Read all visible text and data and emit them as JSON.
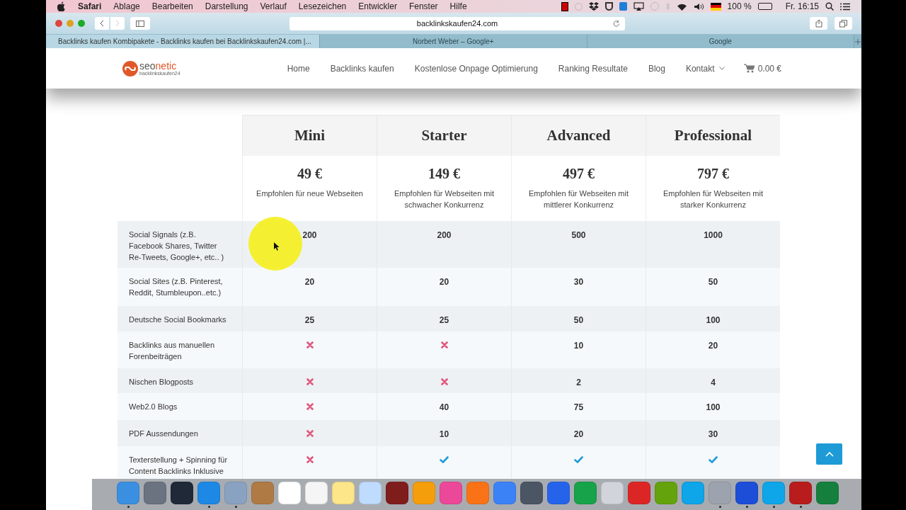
{
  "menubar": {
    "app": "Safari",
    "menus": [
      "Ablage",
      "Bearbeiten",
      "Darstellung",
      "Verlauf",
      "Lesezeichen",
      "Entwickler",
      "Fenster",
      "Hilfe"
    ],
    "battery": "100 %",
    "clock": "Fr. 16:15"
  },
  "toolbar": {
    "address": "backlinkskaufen24.com"
  },
  "tabs": [
    {
      "title": "Backlinks kaufen Kombipakete - Backlinks kaufen bei Backlinkskaufen24.com |...",
      "selected": true
    },
    {
      "title": "Norbert Weber – Google+",
      "selected": false
    },
    {
      "title": "Google",
      "selected": false
    }
  ],
  "site": {
    "logo": {
      "prefix": "seo",
      "suffix": "netic",
      "tagline": "backlinkskaufen24"
    },
    "nav": [
      {
        "label": "Home",
        "dropdown": false
      },
      {
        "label": "Backlinks kaufen",
        "dropdown": false
      },
      {
        "label": "Kostenlose Onpage Optimierung",
        "dropdown": false
      },
      {
        "label": "Ranking Resultate",
        "dropdown": false
      },
      {
        "label": "Blog",
        "dropdown": false
      },
      {
        "label": "Kontakt",
        "dropdown": true
      }
    ],
    "cart": "0.00 €"
  },
  "table": {
    "plans": [
      {
        "name": "Mini",
        "price": "49 €",
        "note": "Empfohlen für neue Webseiten"
      },
      {
        "name": "Starter",
        "price": "149 €",
        "note": "Empfohlen für Webseiten mit schwacher Konkurrenz"
      },
      {
        "name": "Advanced",
        "price": "497 €",
        "note": "Empfohlen für Webseiten mit mittlerer Konkurrenz"
      },
      {
        "name": "Professional",
        "price": "797 €",
        "note": "Empfohlen für Webseiten mit starker Konkurrenz"
      }
    ],
    "rows": [
      {
        "feature": "Social Signals (z.B. Facebook Shares, Twitter Re-Tweets, Google+, etc.. )",
        "cells": [
          {
            "kind": "text",
            "value": "200"
          },
          {
            "kind": "text",
            "value": "200"
          },
          {
            "kind": "text",
            "value": "500"
          },
          {
            "kind": "text",
            "value": "1000"
          }
        ]
      },
      {
        "feature": "Social Sites (z.B. Pinterest, Reddit, Stumbleupon..etc.)",
        "cells": [
          {
            "kind": "text",
            "value": "20"
          },
          {
            "kind": "text",
            "value": "20"
          },
          {
            "kind": "text",
            "value": "30"
          },
          {
            "kind": "text",
            "value": "50"
          }
        ]
      },
      {
        "feature": "Deutsche Social Bookmarks",
        "cells": [
          {
            "kind": "text",
            "value": "25"
          },
          {
            "kind": "text",
            "value": "25"
          },
          {
            "kind": "text",
            "value": "50"
          },
          {
            "kind": "text",
            "value": "100"
          }
        ]
      },
      {
        "feature": "Backlinks aus manuellen Forenbeiträgen",
        "cells": [
          {
            "kind": "cross"
          },
          {
            "kind": "cross"
          },
          {
            "kind": "text",
            "value": "10"
          },
          {
            "kind": "text",
            "value": "20"
          }
        ]
      },
      {
        "feature": "Nischen Blogposts",
        "cells": [
          {
            "kind": "cross"
          },
          {
            "kind": "cross"
          },
          {
            "kind": "text",
            "value": "2"
          },
          {
            "kind": "text",
            "value": "4"
          }
        ]
      },
      {
        "feature": "Web2.0 Blogs",
        "cells": [
          {
            "kind": "cross"
          },
          {
            "kind": "text",
            "value": "40"
          },
          {
            "kind": "text",
            "value": "75"
          },
          {
            "kind": "text",
            "value": "100"
          }
        ]
      },
      {
        "feature": "PDF Aussendungen",
        "cells": [
          {
            "kind": "cross"
          },
          {
            "kind": "text",
            "value": "10"
          },
          {
            "kind": "text",
            "value": "20"
          },
          {
            "kind": "text",
            "value": "30"
          }
        ]
      },
      {
        "feature": "Texterstellung + Spinning für Content Backlinks Inklusive",
        "cells": [
          {
            "kind": "cross"
          },
          {
            "kind": "check"
          },
          {
            "kind": "check"
          },
          {
            "kind": "check"
          }
        ]
      }
    ]
  },
  "dock": [
    {
      "running": true
    },
    {
      "running": false
    },
    {
      "running": false
    },
    {
      "running": true
    },
    {
      "running": true
    },
    {
      "running": false
    },
    {
      "running": false
    },
    {
      "running": false
    },
    {
      "running": false
    },
    {
      "running": false
    },
    {
      "running": false
    },
    {
      "running": false
    },
    {
      "running": false
    },
    {
      "running": false
    },
    {
      "running": false
    },
    {
      "running": false
    },
    {
      "running": false
    },
    {
      "running": false
    },
    {
      "running": false
    },
    {
      "running": false
    },
    {
      "running": false
    },
    {
      "running": false
    },
    {
      "running": true
    },
    {
      "running": true
    },
    {
      "running": true
    },
    {
      "running": true
    },
    {
      "running": false
    }
  ]
}
